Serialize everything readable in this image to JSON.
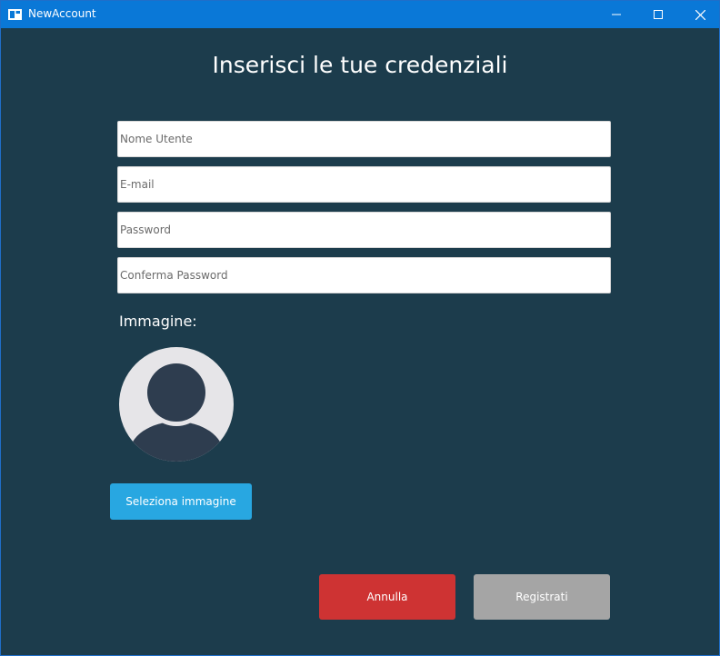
{
  "window": {
    "title": "NewAccount"
  },
  "titlebar_controls": {
    "minimize_icon": "minimize-icon",
    "maximize_icon": "maximize-icon",
    "close_icon": "close-icon"
  },
  "form": {
    "heading": "Inserisci le tue credenziali",
    "fields": [
      {
        "placeholder": "Nome Utente",
        "value": ""
      },
      {
        "placeholder": "E-mail",
        "value": ""
      },
      {
        "placeholder": "Password",
        "value": ""
      },
      {
        "placeholder": "Conferma Password",
        "value": ""
      }
    ],
    "image_label": "Immagine:",
    "select_image_label": "Seleziona immagine"
  },
  "actions": {
    "cancel_label": "Annulla",
    "register_label": "Registrati"
  },
  "colors": {
    "titlebar": "#0a78d7",
    "background": "#1c3c4c",
    "select_button": "#28a7e1",
    "cancel_button": "#ce3333",
    "register_button": "#a5a5a5"
  }
}
